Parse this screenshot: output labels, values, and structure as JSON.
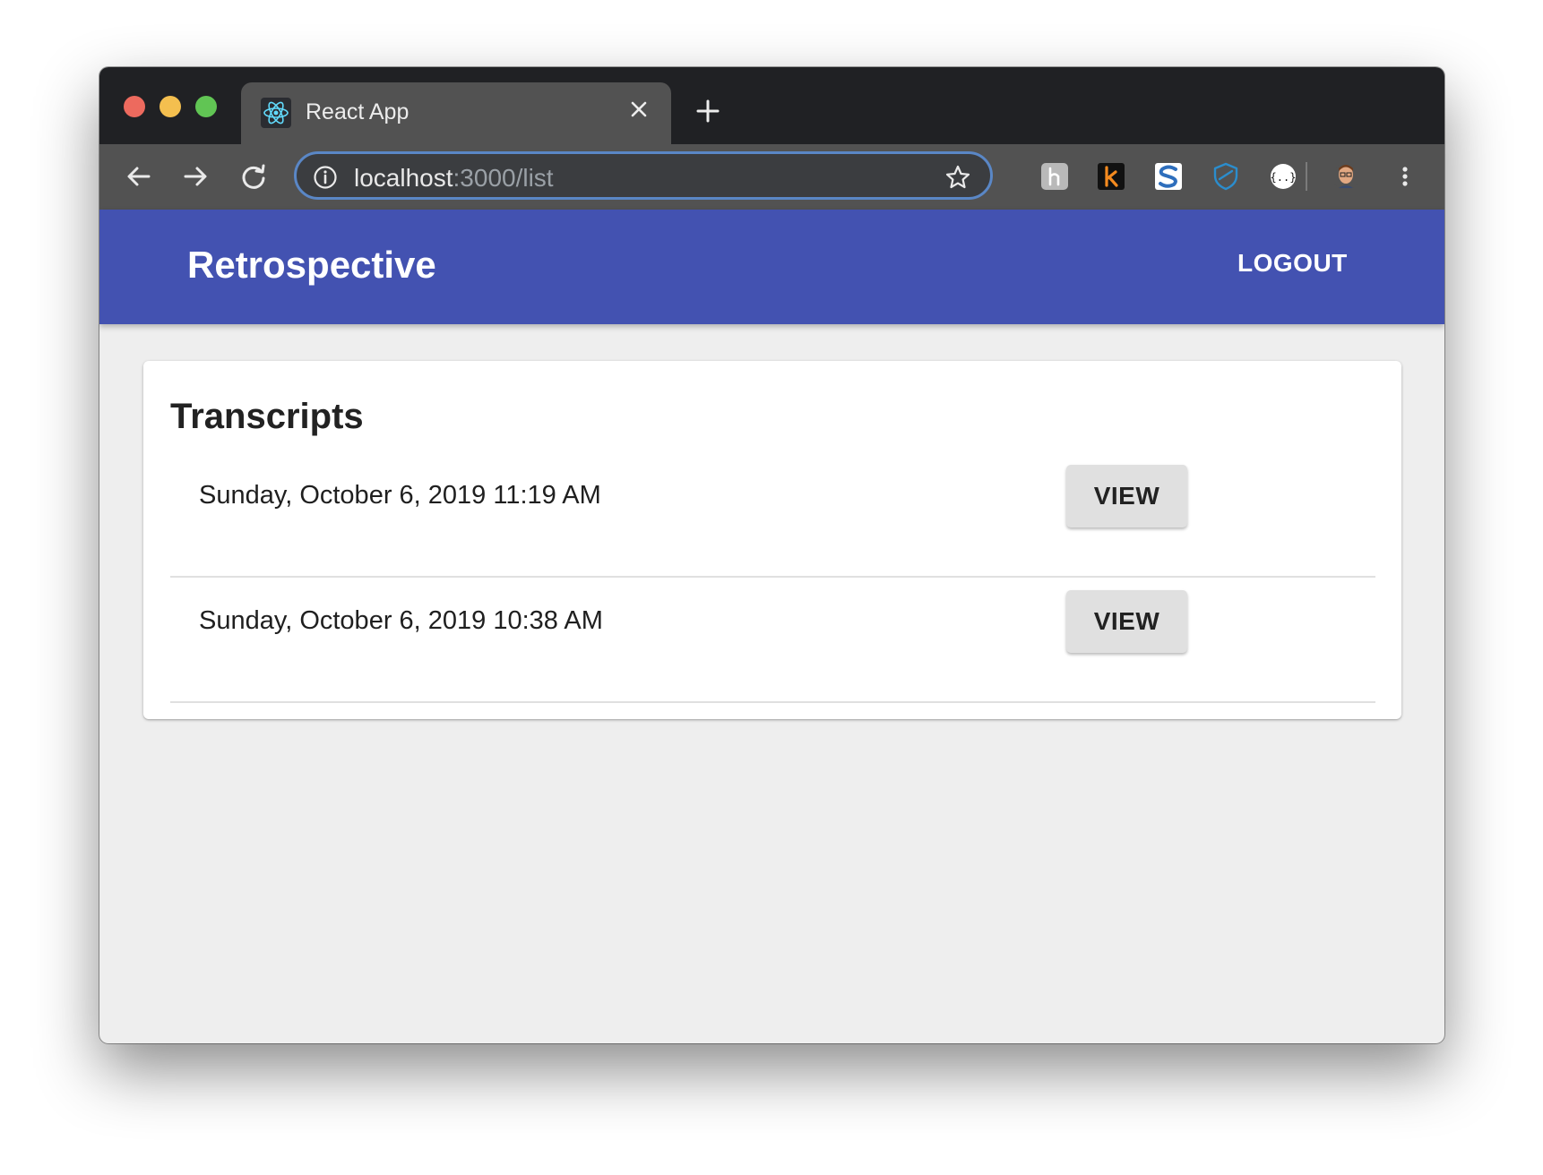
{
  "browser": {
    "tab_title": "React App",
    "url_host": "localhost",
    "url_path": ":3000/list"
  },
  "app": {
    "title": "Retrospective",
    "logout_label": "LOGOUT"
  },
  "transcripts": {
    "heading": "Transcripts",
    "items": [
      {
        "date": "Sunday, October 6, 2019 11:19 AM",
        "action": "VIEW"
      },
      {
        "date": "Sunday, October 6, 2019 10:38 AM",
        "action": "VIEW"
      }
    ]
  },
  "colors": {
    "appbar": "#4352b1",
    "tabstrip": "#202124",
    "toolbar": "#525252",
    "page_bg": "#eeeeee"
  }
}
